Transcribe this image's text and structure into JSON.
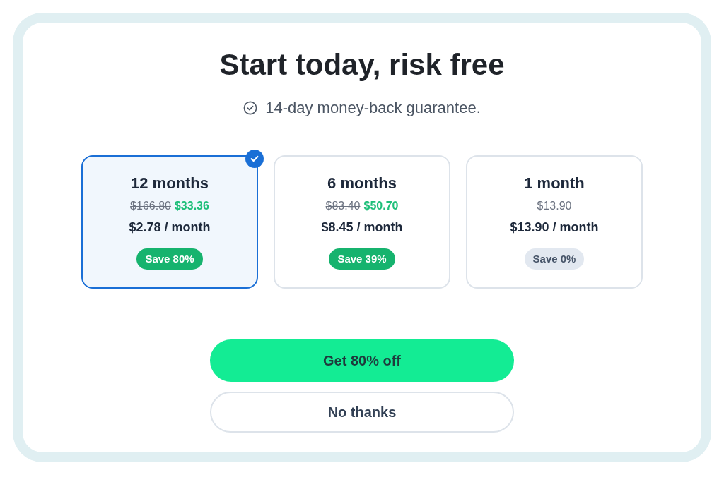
{
  "title": "Start today, risk free",
  "guarantee": "14-day money-back guarantee.",
  "plans": [
    {
      "name": "12 months",
      "selected": true,
      "kind": "discounted",
      "original_price": "$166.80",
      "price": "$33.36",
      "per_month": "$2.78 / month",
      "badge": {
        "label": "Save 80%",
        "kind": "positive"
      }
    },
    {
      "name": "6 months",
      "selected": false,
      "kind": "discounted",
      "original_price": "$83.40",
      "price": "$50.70",
      "per_month": "$8.45 / month",
      "badge": {
        "label": "Save 39%",
        "kind": "positive"
      }
    },
    {
      "name": "1 month",
      "selected": false,
      "kind": "regular",
      "price": "$13.90",
      "per_month": "$13.90 / month",
      "badge": {
        "label": "Save 0%",
        "kind": "neutral"
      }
    }
  ],
  "buttons": [
    {
      "label": "Get 80% off",
      "kind": "primary"
    },
    {
      "label": "No thanks",
      "kind": "secondary"
    }
  ]
}
